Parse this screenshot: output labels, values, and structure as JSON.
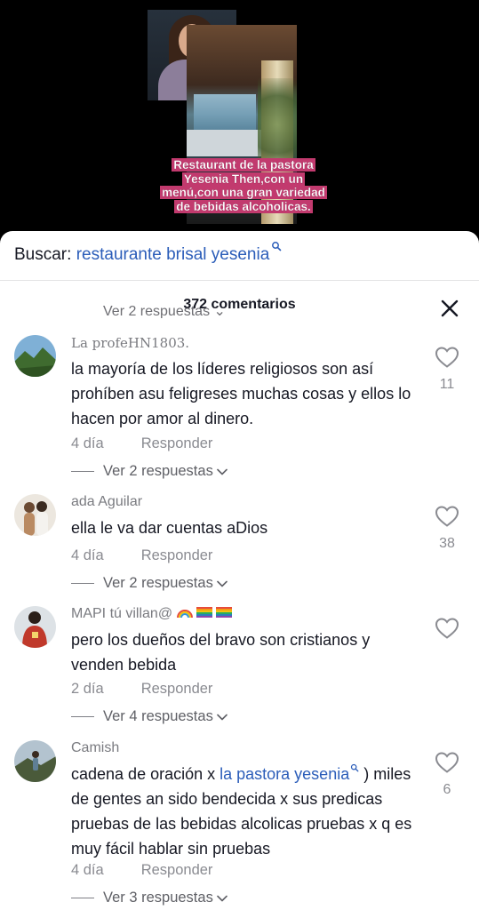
{
  "video": {
    "caption": "Restaurant de la pastora Yesenia Then,con un menú,con una gran variedad de bebidas alcoholicas."
  },
  "search": {
    "label": "Buscar:",
    "query": "restaurante brisal yesenia",
    "icon": "search-icon"
  },
  "comments_header": {
    "count_label": "372 comentarios",
    "partial_replies_label": "Ver 2 respuestas ⌄"
  },
  "comments": [
    {
      "username": "La profeHN1803.",
      "text": "la mayoría de los líderes religiosos son así prohíben asu feligreses muchas cosas y ellos lo hacen por amor al dinero.",
      "age": "4 día",
      "reply_label": "Responder",
      "replies_label": "Ver 2 respuestas",
      "likes": "11",
      "avatar_colors": [
        "#6aa0c8",
        "#3d6b2a"
      ]
    },
    {
      "username": "ada Aguilar",
      "text": "ella le va dar cuentas aDios",
      "age": "4 día",
      "reply_label": "Responder",
      "replies_label": "Ver 2 respuestas",
      "likes": "38",
      "avatar_colors": [
        "#e8e2d8",
        "#b98a62"
      ]
    },
    {
      "username": "MAPI tú villan@",
      "text": "pero los dueños del bravo son cristianos y venden bebida",
      "age": "2 día",
      "reply_label": "Responder",
      "replies_label": "Ver 4 respuestas",
      "likes": "",
      "avatar_colors": [
        "#d8dde2",
        "#c0392b"
      ]
    },
    {
      "username": "Camish",
      "text_prefix": "cadena de oración x ",
      "mention": "la pastora yesenia",
      "text_suffix_1": " )",
      "text_rest": "miles de gentes an sido bendecida x sus predicas pruebas de las bebidas alcolicas pruebas x q es muy fácil hablar sin pruebas",
      "age": "4 día",
      "reply_label": "Responder",
      "replies_label": "Ver 3 respuestas",
      "likes": "6",
      "avatar_colors": [
        "#9fb3c4",
        "#4a5a3a"
      ]
    }
  ]
}
